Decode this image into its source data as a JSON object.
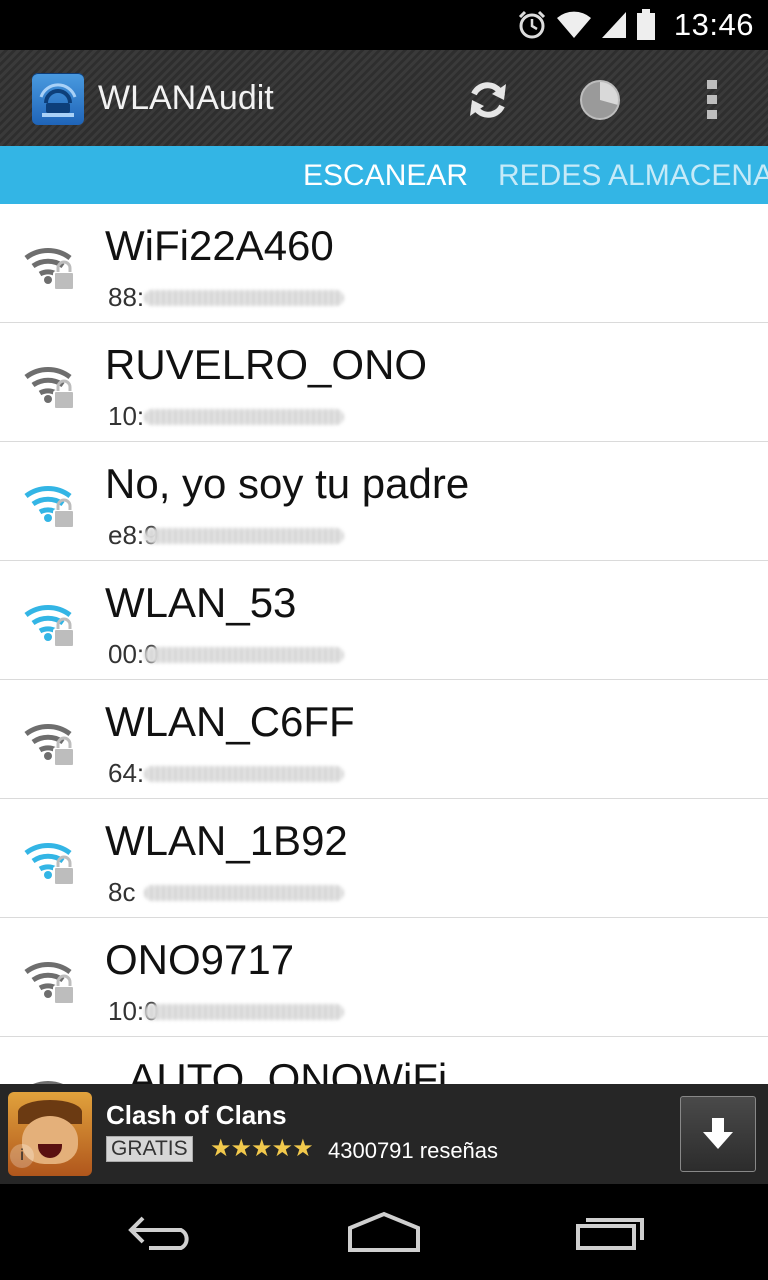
{
  "status_bar": {
    "time": "13:46",
    "icons": [
      "alarm-icon",
      "wifi-icon",
      "signal-icon",
      "battery-icon"
    ]
  },
  "action_bar": {
    "app_icon": "wlanaudit-app-icon",
    "title": "WLANAudit",
    "actions": [
      {
        "name": "refresh-icon"
      },
      {
        "name": "pie-chart-icon"
      },
      {
        "name": "overflow-menu-icon"
      }
    ]
  },
  "tabs": [
    {
      "label": "ESCANEAR",
      "active": true
    },
    {
      "label": "REDES ALMACENADAS",
      "active": false
    }
  ],
  "networks": [
    {
      "ssid": "WiFi22A460",
      "bssid": "88:",
      "signal_color": "gray"
    },
    {
      "ssid": "RUVELRO_ONO",
      "bssid": "10:",
      "signal_color": "gray"
    },
    {
      "ssid": "No, yo soy tu padre",
      "bssid": "e8:9",
      "signal_color": "blue"
    },
    {
      "ssid": "WLAN_53",
      "bssid": "00:0",
      "signal_color": "blue"
    },
    {
      "ssid": "WLAN_C6FF",
      "bssid": "64:",
      "signal_color": "gray"
    },
    {
      "ssid": "WLAN_1B92",
      "bssid": "8c",
      "signal_color": "blue"
    },
    {
      "ssid": "ONO9717",
      "bssid": "10:0",
      "signal_color": "gray"
    },
    {
      "ssid": "_AUTO_ONOWiFi",
      "bssid": "",
      "signal_color": "gray"
    }
  ],
  "ad": {
    "title": "Clash of Clans",
    "badge": "GRATIS",
    "stars": "★★★★★",
    "reviews": "4300791 reseñas"
  },
  "nav_bar": {
    "buttons": [
      "back-icon",
      "home-icon",
      "recent-apps-icon"
    ]
  },
  "colors": {
    "accent": "#33b5e5",
    "wifi_blue": "#33b5e5",
    "wifi_gray": "#6e6e6e"
  }
}
